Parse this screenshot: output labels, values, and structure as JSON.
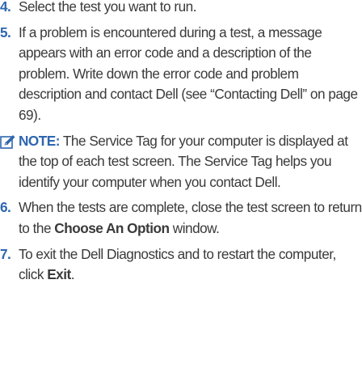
{
  "steps": [
    {
      "number": "4.",
      "text": "Select the test you want to run."
    },
    {
      "number": "5.",
      "text": "If a problem is encountered during a test, a message appears with an error code and a description of the problem. Write down the error code and problem description and contact Dell (see “Contacting Dell” on page 69)."
    }
  ],
  "note": {
    "icon": "pencil-note-icon",
    "label": "NOTE:",
    "text": " The Service Tag for your computer is displayed at the top of each test screen. The Service Tag helps you identify your computer when you contact Dell."
  },
  "step6": {
    "number": "6.",
    "text_before": "When the tests are complete, close the test screen to return to the ",
    "bold": "Choose An Option",
    "text_after": " window."
  },
  "step7": {
    "number": "7.",
    "text_before": "To exit the Dell Diagnostics and to restart the computer, click ",
    "bold": "Exit",
    "text_after": "."
  },
  "colors": {
    "accent": "#2e66b0",
    "text": "#3a3a3a"
  }
}
